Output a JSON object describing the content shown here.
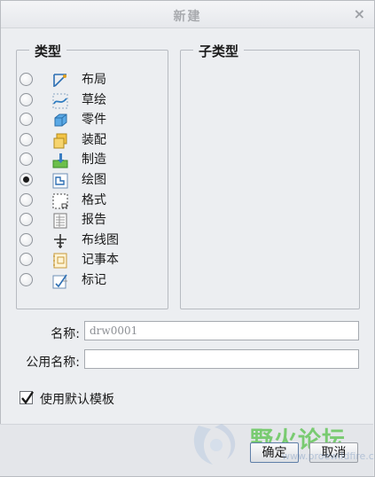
{
  "dialog": {
    "title": "新建",
    "close_glyph": "×"
  },
  "type_group": {
    "title": "类型",
    "items": [
      {
        "label": "布局",
        "icon": "layout-icon",
        "selected": false
      },
      {
        "label": "草绘",
        "icon": "sketch-icon",
        "selected": false
      },
      {
        "label": "零件",
        "icon": "part-icon",
        "selected": false
      },
      {
        "label": "装配",
        "icon": "assembly-icon",
        "selected": false
      },
      {
        "label": "制造",
        "icon": "manufacturing-icon",
        "selected": false
      },
      {
        "label": "绘图",
        "icon": "drawing-icon",
        "selected": true
      },
      {
        "label": "格式",
        "icon": "format-icon",
        "selected": false
      },
      {
        "label": "报告",
        "icon": "report-icon",
        "selected": false
      },
      {
        "label": "布线图",
        "icon": "diagram-icon",
        "selected": false
      },
      {
        "label": "记事本",
        "icon": "notebook-icon",
        "selected": false
      },
      {
        "label": "标记",
        "icon": "markup-icon",
        "selected": false
      }
    ]
  },
  "subtype_group": {
    "title": "子类型"
  },
  "name_field": {
    "label": "名称:",
    "value": "drw0001"
  },
  "common_name_field": {
    "label": "公用名称:",
    "value": ""
  },
  "use_default_template": {
    "label": "使用默认模板",
    "checked": true
  },
  "buttons": {
    "ok": "确定",
    "cancel": "取消"
  },
  "watermark": {
    "text": "野火论坛",
    "url": "www.proewildfire.cn"
  }
}
